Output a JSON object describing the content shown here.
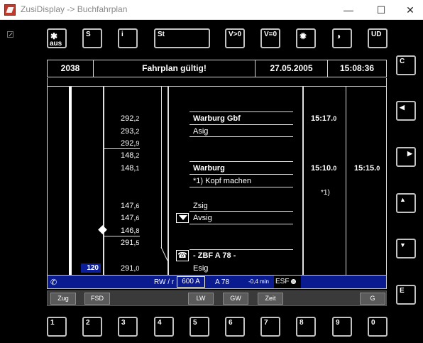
{
  "window": {
    "title": "ZusiDisplay -> Buchfahrplan",
    "minimize": "—",
    "maximize": "☐",
    "close": "✕"
  },
  "top_buttons": [
    {
      "label": "✱",
      "label2": "aus"
    },
    {
      "label": "S"
    },
    {
      "label": "i"
    },
    {
      "label": "St"
    },
    {
      "label": "V>0"
    },
    {
      "label": "V=0"
    },
    {
      "label": "✹"
    },
    {
      "label": "◑"
    },
    {
      "label": "UD"
    }
  ],
  "side_buttons": [
    {
      "label": "C"
    },
    {
      "label": "◀"
    },
    {
      "label": "▶"
    },
    {
      "label": "▲"
    },
    {
      "label": "▼"
    },
    {
      "label": "E"
    }
  ],
  "bottom_buttons": [
    "1",
    "2",
    "3",
    "4",
    "5",
    "6",
    "7",
    "8",
    "9",
    "0"
  ],
  "header": {
    "train_number": "2038",
    "status": "Fahrplan gültig!",
    "date": "27.05.2005",
    "time": "15:08:36"
  },
  "rows": {
    "km": [
      {
        "main": "292,",
        "sub": "2"
      },
      {
        "main": "293,",
        "sub": "2"
      },
      {
        "main": "292,",
        "sub": "9"
      },
      {
        "main": "148,",
        "sub": "2"
      },
      {
        "main": "148,",
        "sub": "1"
      },
      {
        "main": "147,",
        "sub": "6"
      },
      {
        "main": "147,",
        "sub": "6"
      },
      {
        "main": "146,",
        "sub": "8"
      },
      {
        "main": "291,",
        "sub": "5"
      },
      {
        "main": "291,",
        "sub": "0"
      }
    ],
    "stations": [
      {
        "name": "Warburg Gbf",
        "bold": true
      },
      {
        "name": "Asig",
        "bold": false
      },
      {
        "name": "Warburg",
        "bold": true
      },
      {
        "name": "*1) Kopf machen",
        "bold": false
      },
      {
        "name": "Zsig",
        "bold": false
      },
      {
        "name": "Avsig",
        "bold": false
      },
      {
        "name": "- ZBF A 78 -",
        "bold": true
      },
      {
        "name": "Esig",
        "bold": false
      }
    ],
    "arrivals": [
      {
        "main": "15:17.",
        "sub": "0"
      },
      {
        "main": "15:10.",
        "sub": "0"
      }
    ],
    "footnote": "*1)",
    "departure": {
      "main": "15:15.",
      "sub": "0"
    },
    "speed_limit": "120"
  },
  "status": {
    "mode": "RW / r",
    "brake": "600 A",
    "zbf": "A 78",
    "delay": "-0,4 min",
    "esf": "ESF"
  },
  "softkeys": [
    "Zug",
    "FSD",
    "LW",
    "GW",
    "Zeit",
    "G"
  ],
  "colors": {
    "status_blue": "#0a1a8f",
    "background": "#000000",
    "foreground": "#ffffff"
  }
}
